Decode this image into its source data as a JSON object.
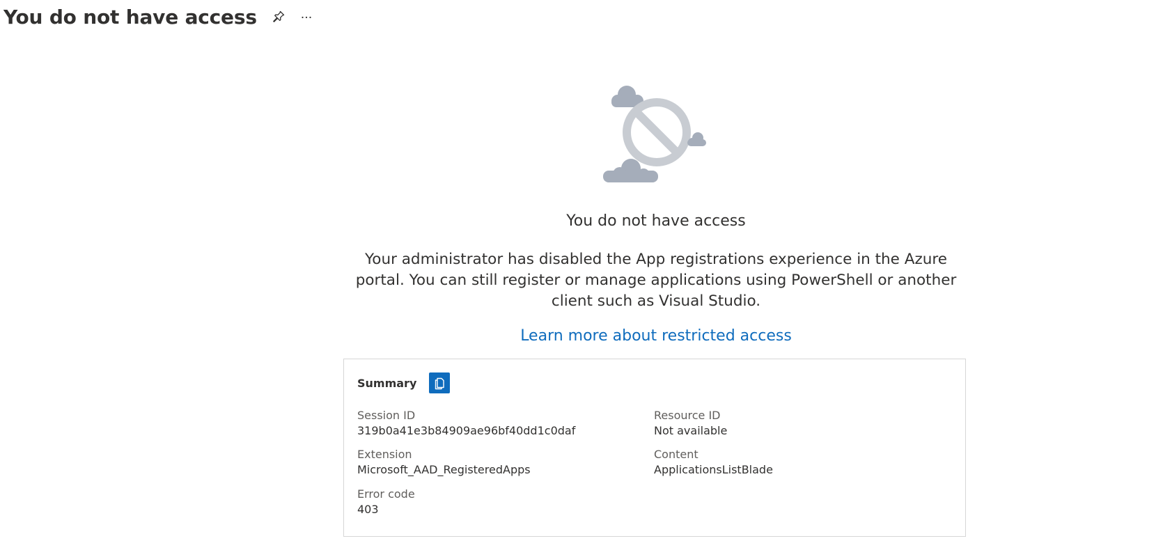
{
  "header": {
    "title": "You do not have access",
    "pin_icon": "pin-icon",
    "more_icon": "more-ellipsis-icon"
  },
  "hero": {
    "icon": "no-access-cloud-icon",
    "colors": {
      "cloud": "#a5adba",
      "circle": "#c8ccd2"
    }
  },
  "message": {
    "title": "You do not have access",
    "description": "Your administrator has disabled the App registrations experience in the Azure portal. You can still register or manage applications using PowerShell or another client such as Visual Studio.",
    "link": "Learn more about restricted access"
  },
  "summary": {
    "title": "Summary",
    "copy_icon": "copy-icon",
    "fields": {
      "session_id": {
        "label": "Session ID",
        "value": "319b0a41e3b84909ae96bf40dd1c0daf"
      },
      "resource_id": {
        "label": "Resource ID",
        "value": "Not available"
      },
      "extension": {
        "label": "Extension",
        "value": "Microsoft_AAD_RegisteredApps"
      },
      "content": {
        "label": "Content",
        "value": "ApplicationsListBlade"
      },
      "error_code": {
        "label": "Error code",
        "value": "403"
      }
    }
  },
  "colors": {
    "link": "#0f6cbd",
    "accent": "#0f6cbd",
    "text": "#323130",
    "label": "#605e5c",
    "border": "#d6d6d6"
  }
}
